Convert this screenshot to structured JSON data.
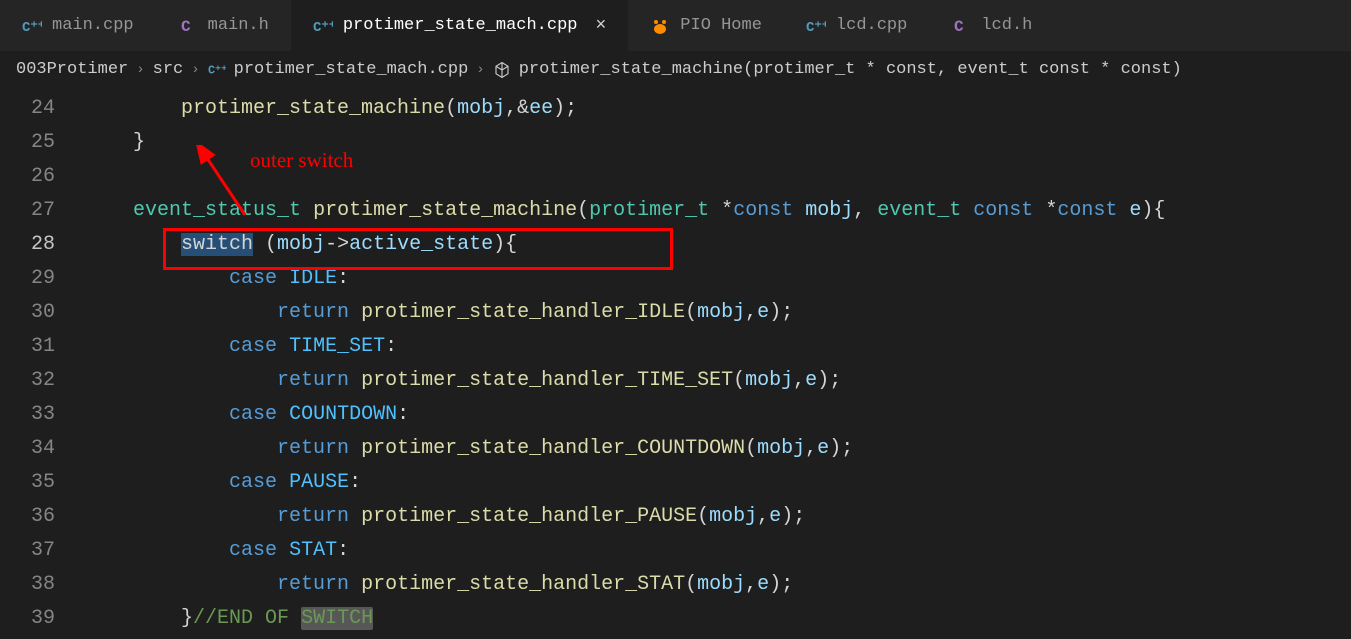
{
  "tabs": [
    {
      "label": "main.cpp",
      "ext": "cpp",
      "iconColor": "#519aba"
    },
    {
      "label": "main.h",
      "ext": "h",
      "iconColor": "#a074c4"
    },
    {
      "label": "protimer_state_mach.cpp",
      "ext": "cpp",
      "iconColor": "#519aba",
      "active": true
    },
    {
      "label": "PIO Home",
      "ext": "pio",
      "iconColor": "#ff8c00"
    },
    {
      "label": "lcd.cpp",
      "ext": "cpp",
      "iconColor": "#519aba"
    },
    {
      "label": "lcd.h",
      "ext": "h",
      "iconColor": "#a074c4"
    }
  ],
  "breadcrumb": {
    "proj": "003Protimer",
    "folder": "src",
    "file": "protimer_state_mach.cpp",
    "symbol": "protimer_state_machine(protimer_t * const, event_t const * const)"
  },
  "annotation": {
    "text": "outer switch"
  },
  "lines": {
    "n24": "24",
    "n25": "25",
    "n26": "26",
    "n27": "27",
    "n28": "28",
    "n29": "29",
    "n30": "30",
    "n31": "31",
    "n32": "32",
    "n33": "33",
    "n34": "34",
    "n35": "35",
    "n36": "36",
    "n37": "37",
    "n38": "38",
    "n39": "39"
  },
  "code": {
    "l24": {
      "func": "protimer_state_machine",
      "args_open": "(",
      "arg1": "mobj",
      "comma": ",",
      "amp": "&",
      "arg2": "ee",
      "close": ");"
    },
    "l25": {
      "brace": "}"
    },
    "l27": {
      "type1": "event_status_t",
      "func": "protimer_state_machine",
      "open": "(",
      "type2": "protimer_t",
      "ptr1": "*",
      "kw1": "const",
      "arg1": "mobj",
      "comma": ",",
      "type3": "event_t",
      "kw2": "const",
      "ptr2": "*",
      "kw3": "const",
      "arg2": "e",
      "closebrace": "){"
    },
    "l28": {
      "kw": "switch",
      "open": " (",
      "var": "mobj",
      "arrow": "->",
      "field": "active_state",
      "close": "){"
    },
    "l29": {
      "kw": "case",
      "const": "IDLE",
      "colon": ":"
    },
    "l30": {
      "kw": "return",
      "func": "protimer_state_handler_IDLE",
      "open": "(",
      "arg1": "mobj",
      "comma": ",",
      "arg2": "e",
      "close": ");"
    },
    "l31": {
      "kw": "case",
      "const": "TIME_SET",
      "colon": ":"
    },
    "l32": {
      "kw": "return",
      "func": "protimer_state_handler_TIME_SET",
      "open": "(",
      "arg1": "mobj",
      "comma": ",",
      "arg2": "e",
      "close": ");"
    },
    "l33": {
      "kw": "case",
      "const": "COUNTDOWN",
      "colon": ":"
    },
    "l34": {
      "kw": "return",
      "func": "protimer_state_handler_COUNTDOWN",
      "open": "(",
      "arg1": "mobj",
      "comma": ",",
      "arg2": "e",
      "close": ");"
    },
    "l35": {
      "kw": "case",
      "const": "PAUSE",
      "colon": ":"
    },
    "l36": {
      "kw": "return",
      "func": "protimer_state_handler_PAUSE",
      "open": "(",
      "arg1": "mobj",
      "comma": ",",
      "arg2": "e",
      "close": ");"
    },
    "l37": {
      "kw": "case",
      "const": "STAT",
      "colon": ":"
    },
    "l38": {
      "kw": "return",
      "func": "protimer_state_handler_STAT",
      "open": "(",
      "arg1": "mobj",
      "comma": ",",
      "arg2": "e",
      "close": ");"
    },
    "l39": {
      "brace": "}",
      "comment": "//END OF SWITCH",
      "hl": "SWITCH"
    }
  }
}
